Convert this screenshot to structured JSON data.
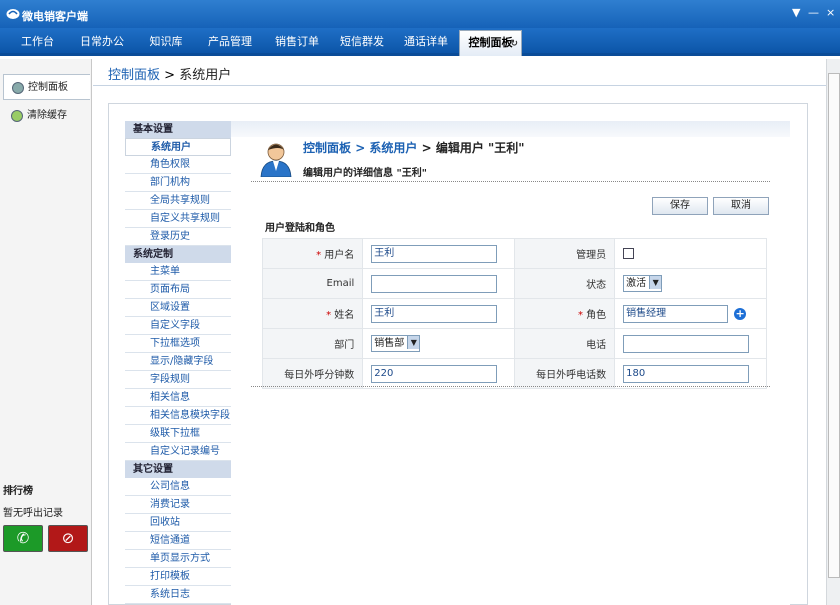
{
  "app": {
    "title": "微电销客户端",
    "window_controls": [
      "▼",
      "—",
      "×"
    ]
  },
  "nav": {
    "tabs": [
      "工作台",
      "日常办公",
      "知识库",
      "产品管理",
      "销售订单",
      "短信群发",
      "通话详单",
      "控制面板"
    ],
    "active": "控制面板"
  },
  "side": {
    "items": [
      "控制面板",
      "清除缓存"
    ],
    "rank_title": "排行榜",
    "rank_text": "暂无呼出记录",
    "call_icon": "phone-answer-icon",
    "hangup_icon": "phone-hangup-icon"
  },
  "top_breadcrumb": {
    "root": "控制面板",
    "sep": " > ",
    "current": "系统用户"
  },
  "menu": {
    "groups": [
      {
        "title": "基本设置",
        "items": [
          "系统用户",
          "角色权限",
          "部门机构",
          "全局共享规则",
          "自定义共享规则",
          "登录历史"
        ]
      },
      {
        "title": "系统定制",
        "items": [
          "主菜单",
          "页面布局",
          "区域设置",
          "自定义字段",
          "下拉框选项",
          "显示/隐藏字段",
          "字段规则",
          "相关信息",
          "相关信息模块字段",
          "级联下拉框",
          "自定义记录编号"
        ]
      },
      {
        "title": "其它设置",
        "items": [
          "公司信息",
          "消费记录",
          "回收站",
          "短信通道",
          "单页显示方式",
          "打印模板",
          "系统日志"
        ]
      }
    ],
    "active": "系统用户"
  },
  "edit": {
    "crumb_root": "控制面板",
    "crumb_mid": " > 系统用户",
    "crumb_end": " > 编辑用户 \"王利\"",
    "subtitle": "编辑用户的详细信息 \"王利\"",
    "save": "保存",
    "cancel": "取消",
    "section": "用户登陆和角色",
    "fields": {
      "username_label": "用户名",
      "username": "王利",
      "admin_label": "管理员",
      "email_label": "Email",
      "email": "",
      "status_label": "状态",
      "status": "激活",
      "name_label": "姓名",
      "name": "王利",
      "role_label": "角色",
      "role": "销售经理",
      "dept_label": "部门",
      "dept": "销售部",
      "phone_label": "电话",
      "phone": "",
      "minutes_label": "每日外呼分钟数",
      "minutes": "220",
      "calls_label": "每日外呼电话数",
      "calls": "180"
    }
  }
}
